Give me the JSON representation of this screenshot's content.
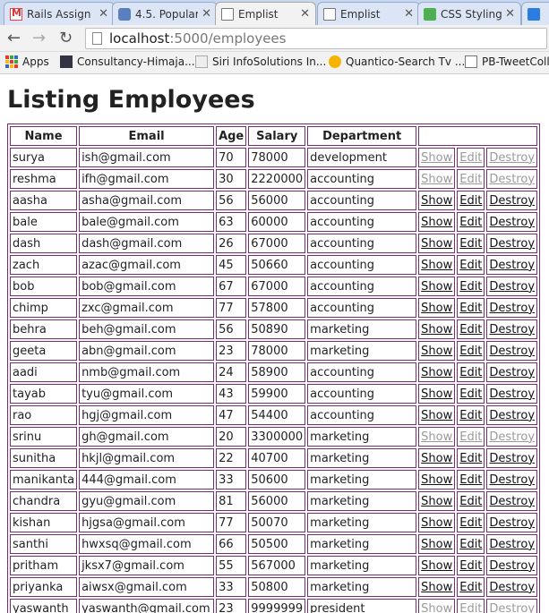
{
  "tabs": [
    {
      "title": "Rails Assign",
      "icon": "gmail-icon",
      "active": false
    },
    {
      "title": "4.5. Popular",
      "icon": "robot-icon",
      "active": false
    },
    {
      "title": "Emplist",
      "icon": "page-icon",
      "active": true
    },
    {
      "title": "Emplist",
      "icon": "page-icon",
      "active": false
    },
    {
      "title": "CSS Styling",
      "icon": "w3schools-icon",
      "active": false
    },
    {
      "title": "",
      "icon": "tab-icon",
      "active": false
    }
  ],
  "address": {
    "host": "localhost",
    "path": ":5000/employees"
  },
  "bookmarks": [
    {
      "label": "Apps",
      "icon": "apps-icon"
    },
    {
      "label": "Consultancy-Himaja...",
      "icon": "usnf-icon"
    },
    {
      "label": "Siri InfoSolutions In...",
      "icon": "siri-icon"
    },
    {
      "label": "Quantico-Search Tv ...",
      "icon": "quantico-icon"
    },
    {
      "label": "PB-TweetColle",
      "icon": "page-icon"
    }
  ],
  "page": {
    "heading": "Listing Employees"
  },
  "table": {
    "headers": [
      "Name",
      "Email",
      "Age",
      "Salary",
      "Department",
      ""
    ],
    "action_labels": {
      "show": "Show",
      "edit": "Edit",
      "destroy": "Destroy"
    },
    "rows": [
      {
        "name": "surya",
        "email": "ish@gmail.com",
        "age": "70",
        "salary": "78000",
        "department": "development"
      },
      {
        "name": "reshma",
        "email": "ifh@gmail.com",
        "age": "30",
        "salary": "2220000",
        "department": "accounting"
      },
      {
        "name": "aasha",
        "email": "asha@gmail.com",
        "age": "56",
        "salary": "56000",
        "department": "accounting"
      },
      {
        "name": "bale",
        "email": "bale@gmail.com",
        "age": "63",
        "salary": "60000",
        "department": "accounting"
      },
      {
        "name": "dash",
        "email": "dash@gmail.com",
        "age": "26",
        "salary": "67000",
        "department": "accounting"
      },
      {
        "name": "zach",
        "email": "azac@gmail.com",
        "age": "45",
        "salary": "50660",
        "department": "accounting"
      },
      {
        "name": "bob",
        "email": "bob@gmail.com",
        "age": "67",
        "salary": "67000",
        "department": "accounting"
      },
      {
        "name": "chimp",
        "email": "zxc@gmail.com",
        "age": "77",
        "salary": "57800",
        "department": "accounting"
      },
      {
        "name": "behra",
        "email": "beh@gmail.com",
        "age": "56",
        "salary": "50890",
        "department": "marketing"
      },
      {
        "name": "geeta",
        "email": "abn@gmail.com",
        "age": "23",
        "salary": "78000",
        "department": "marketing"
      },
      {
        "name": "aadi",
        "email": "nmb@gmail.com",
        "age": "24",
        "salary": "58900",
        "department": "accounting"
      },
      {
        "name": "tayab",
        "email": "tyu@gmail.com",
        "age": "43",
        "salary": "59900",
        "department": "accounting"
      },
      {
        "name": "rao",
        "email": "hgj@gmail.com",
        "age": "47",
        "salary": "54400",
        "department": "accounting"
      },
      {
        "name": "srinu",
        "email": "gh@gmail.com",
        "age": "20",
        "salary": "3300000",
        "department": "marketing"
      },
      {
        "name": "sunitha",
        "email": "hkjl@gmail.com",
        "age": "22",
        "salary": "40700",
        "department": "marketing"
      },
      {
        "name": "manikanta",
        "email": "444@gmail.com",
        "age": "33",
        "salary": "50600",
        "department": "marketing"
      },
      {
        "name": "chandra",
        "email": "gyu@gmail.com",
        "age": "81",
        "salary": "56000",
        "department": "marketing"
      },
      {
        "name": "kishan",
        "email": "hjgsa@gmail.com",
        "age": "77",
        "salary": "50070",
        "department": "marketing"
      },
      {
        "name": "santhi",
        "email": "hwxsq@gmail.com",
        "age": "66",
        "salary": "50500",
        "department": "marketing"
      },
      {
        "name": "pritham",
        "email": "jksx7@gmail.com",
        "age": "55",
        "salary": "567000",
        "department": "marketing"
      },
      {
        "name": "priyanka",
        "email": "aiwsx@gmail.com",
        "age": "33",
        "salary": "50800",
        "department": "marketing"
      },
      {
        "name": "yaswanth",
        "email": "yaswanth@gmail.com",
        "age": "23",
        "salary": "9999999",
        "department": "president"
      }
    ],
    "dimmed_rows": [
      0,
      1,
      13,
      21
    ]
  }
}
